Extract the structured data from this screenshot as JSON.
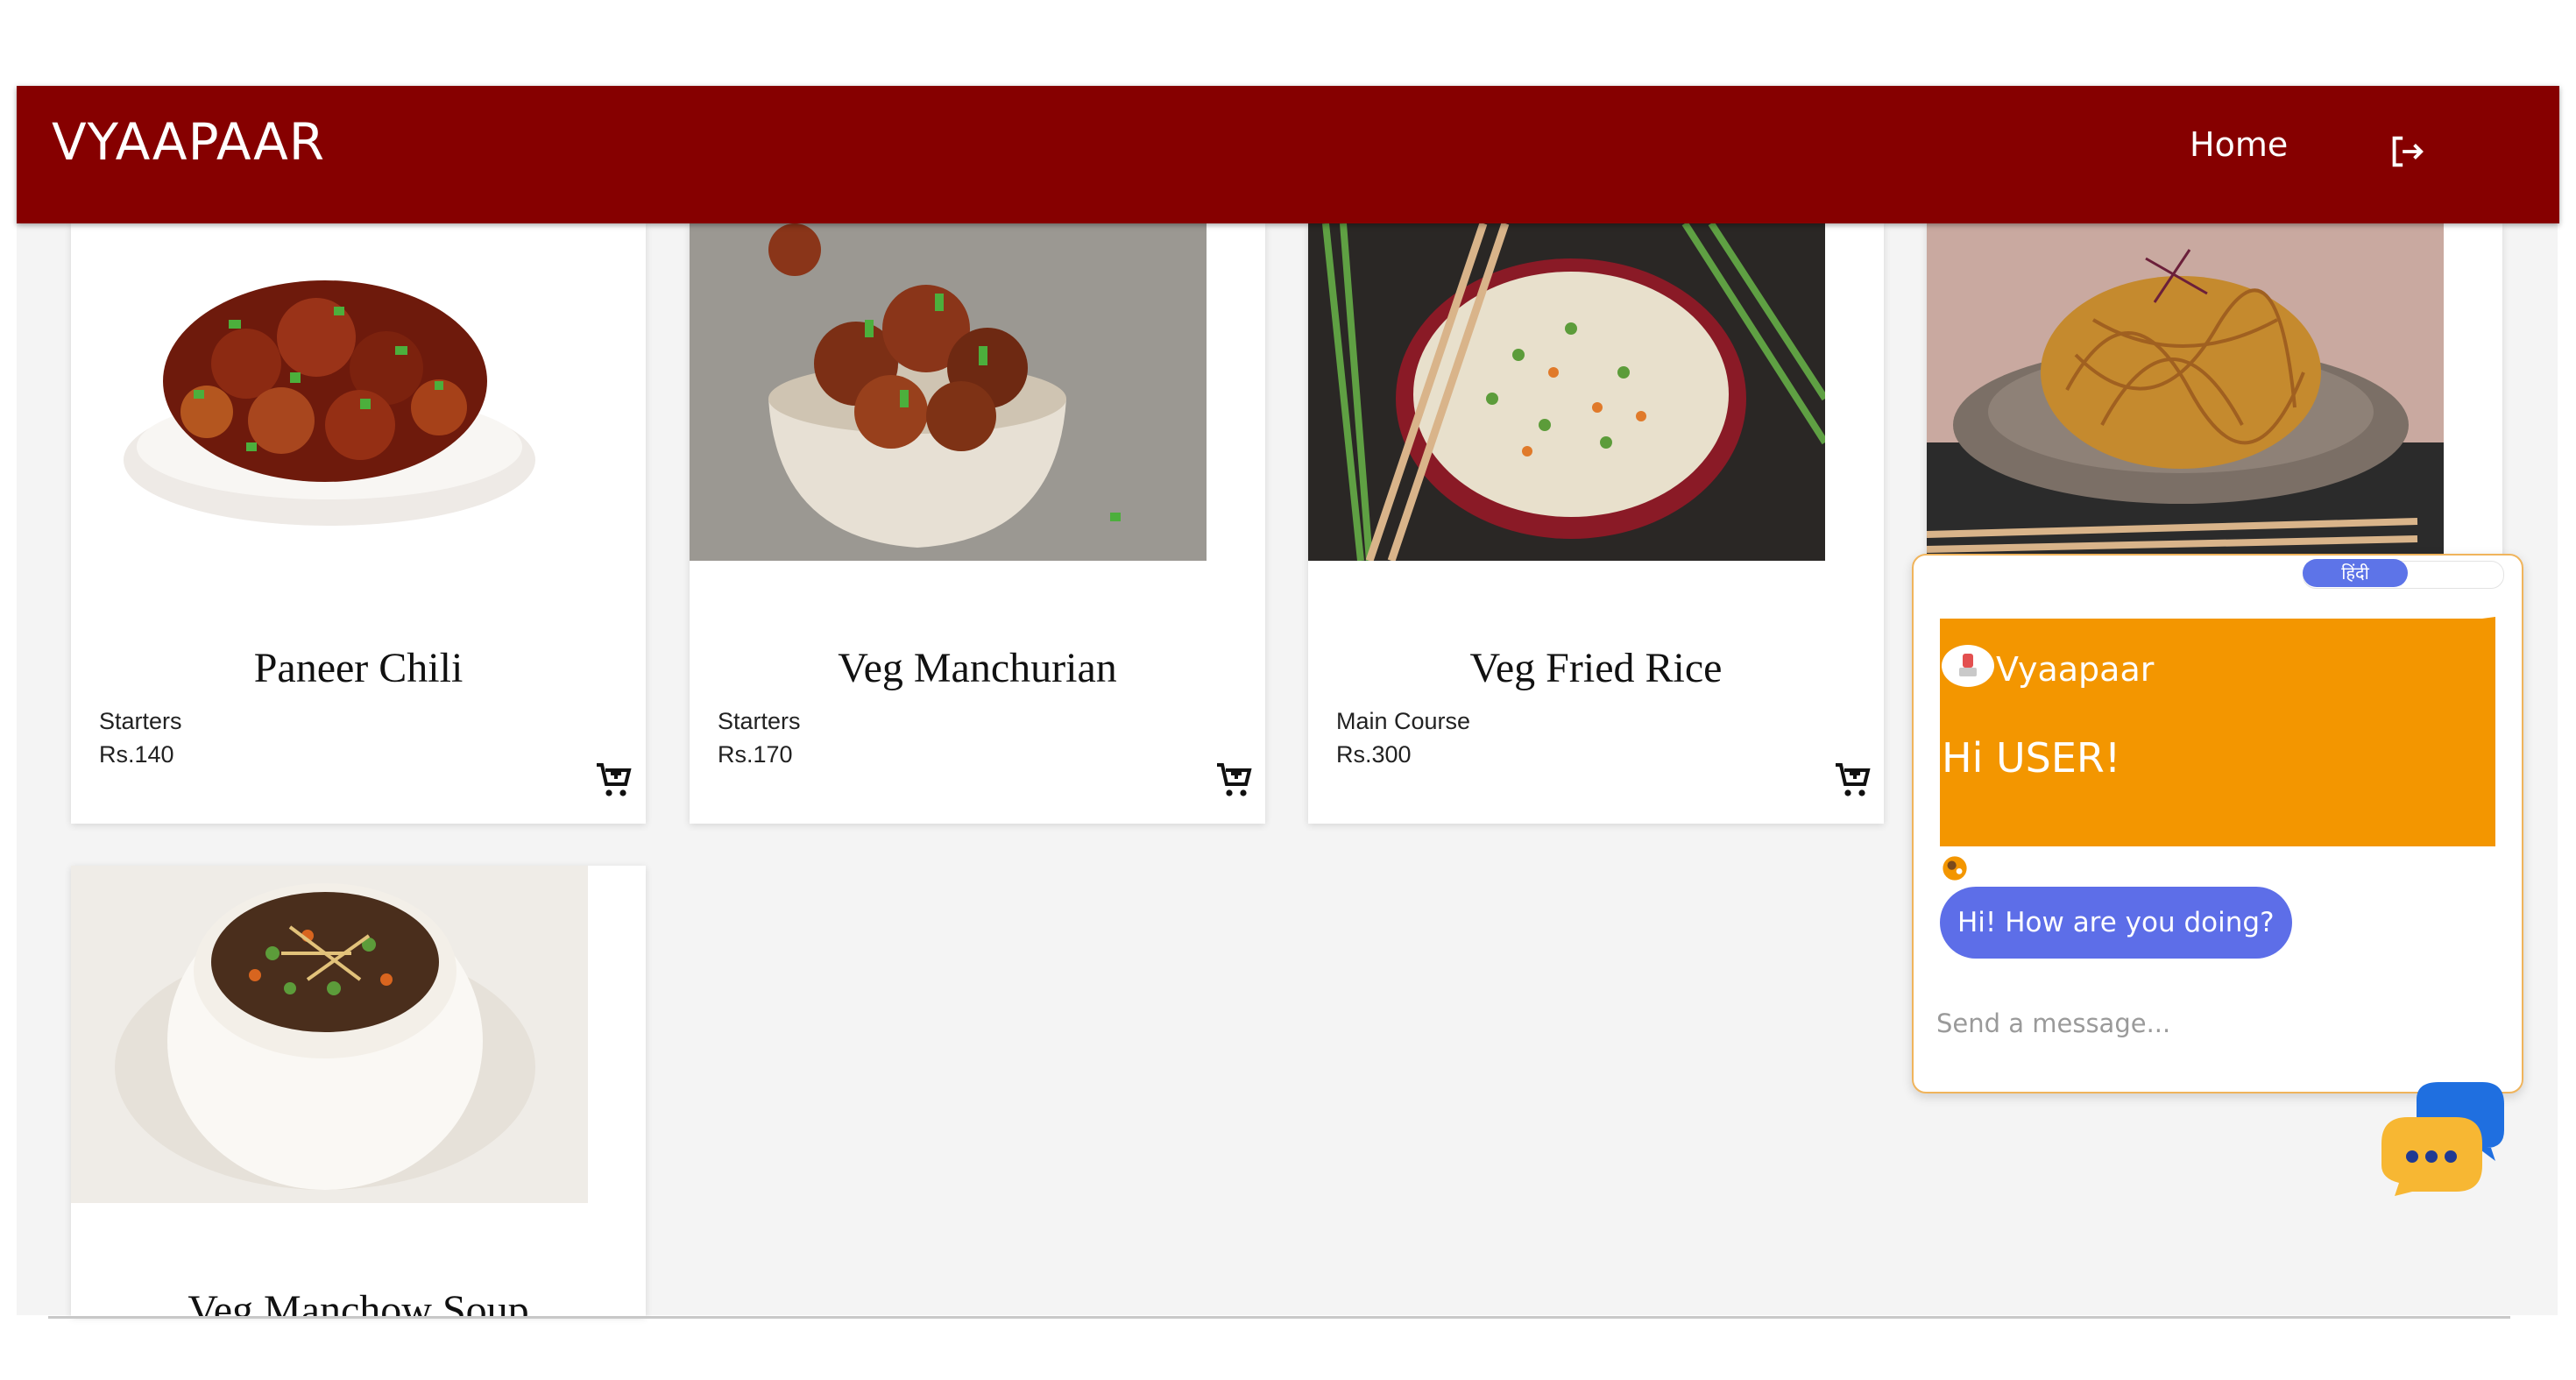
{
  "nav": {
    "brand": "VYAAPAAR",
    "home_label": "Home",
    "logout_icon": "logout-icon"
  },
  "products": [
    {
      "name": "Paneer Chili",
      "category": "Starters",
      "price": "Rs.140",
      "image": "paneer-chili-photo"
    },
    {
      "name": "Veg Manchurian",
      "category": "Starters",
      "price": "Rs.170",
      "image": "veg-manchurian-photo"
    },
    {
      "name": "Veg Fried Rice",
      "category": "Main Course",
      "price": "Rs.300",
      "image": "veg-fried-rice-photo"
    },
    {
      "name": "",
      "category": "",
      "price": "",
      "image": "noodles-photo"
    },
    {
      "name": "Veg Manchow Soup",
      "category": "",
      "price": "",
      "image": "manchow-soup-photo"
    }
  ],
  "chat": {
    "language_toggle": "हिंदी",
    "bot_name": "Vyaapaar",
    "greeting": "Hi USER!",
    "message": "Hi! How are you doing?",
    "input_placeholder": "Send a message..."
  },
  "colors": {
    "navbar": "#860000",
    "chat_header": "#f39600",
    "chat_bubble": "#5d6ee8",
    "chat_border": "#f0b45c"
  }
}
